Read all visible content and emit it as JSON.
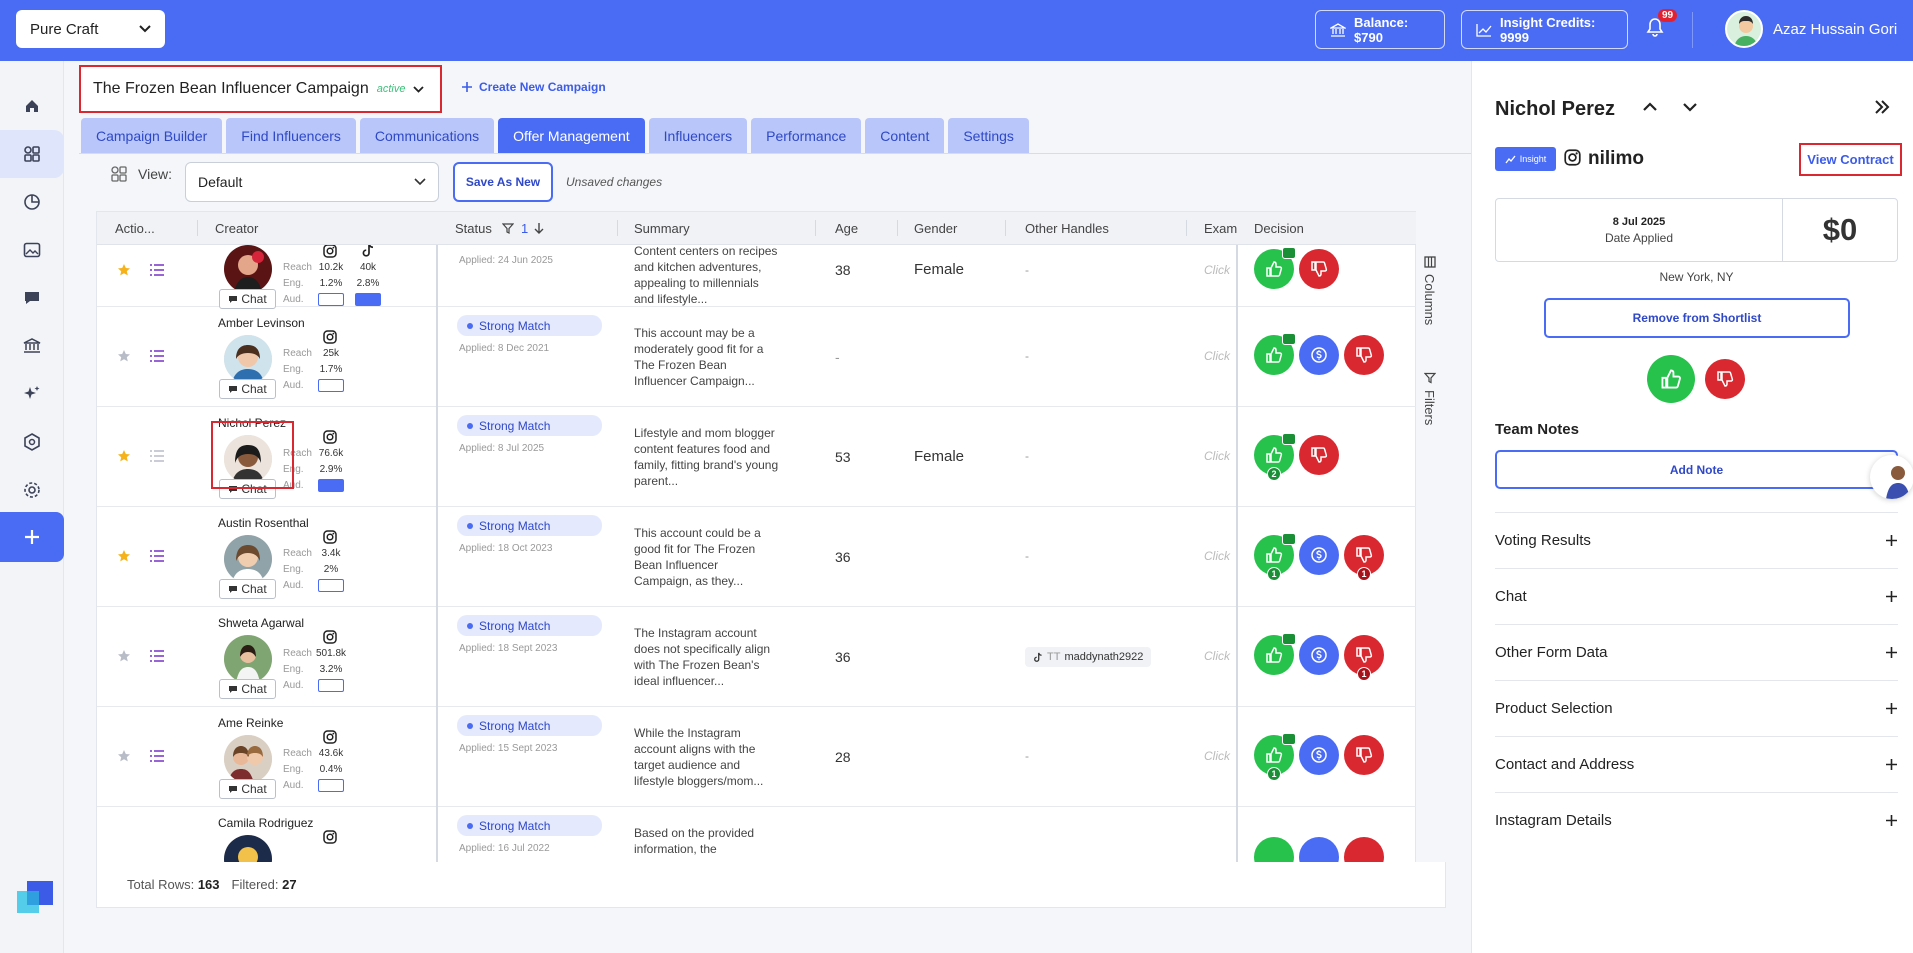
{
  "topbar": {
    "workspace": "Pure Craft",
    "balance": "Balance: $790",
    "credits": "Insight Credits: 9999",
    "notif_count": "99",
    "user_name": "Azaz Hussain Gori",
    "color": "#4a6cf4"
  },
  "campaign": {
    "title": "The Frozen Bean Influencer Campaign",
    "status": "active",
    "create_label": "Create New Campaign"
  },
  "tabs": [
    "Campaign Builder",
    "Find Influencers",
    "Communications",
    "Offer Management",
    "Influencers",
    "Performance",
    "Content",
    "Settings"
  ],
  "active_tab": "Offer Management",
  "view": {
    "label": "View:",
    "selected": "Default",
    "save_label": "Save As New",
    "unsaved": "Unsaved changes"
  },
  "table": {
    "headers": {
      "actions": "Actio...",
      "creator": "Creator",
      "status": "Status",
      "status_filter_count": "1",
      "summary": "Summary",
      "age": "Age",
      "gender": "Gender",
      "other_handles": "Other Handles",
      "exam": "Exam",
      "decision": "Decision"
    },
    "metric_labels": {
      "reach": "Reach",
      "eng": "Eng.",
      "aud": "Aud."
    },
    "chat_label": "Chat",
    "click_text": "Click",
    "rows": [
      {
        "name": "",
        "status": "",
        "applied": "Applied: 24 Jun 2025",
        "summary": "Content centers on recipes and kitchen adventures, appealing to millennials and lifestyle...",
        "age": "38",
        "gender": "Female",
        "handles": "-",
        "reach": "10.2k",
        "reach2": "40k",
        "eng": "1.2%",
        "eng2": "2.8%",
        "starred": true
      },
      {
        "name": "Amber Levinson",
        "status": "Strong Match",
        "applied": "Applied: 8 Dec 2021",
        "summary": "This account may be a moderately good fit for a The Frozen Bean Influencer Campaign...",
        "age": "-",
        "gender": "",
        "handles": "-",
        "reach": "25k",
        "eng": "1.7%",
        "starred": false
      },
      {
        "name": "Nichol Perez",
        "status": "Strong Match",
        "applied": "Applied: 8 Jul 2025",
        "summary": "Lifestyle and mom blogger content features food and family, fitting brand's young parent...",
        "age": "53",
        "gender": "Female",
        "handles": "-",
        "reach": "76.6k",
        "eng": "2.9%",
        "starred": true,
        "up_count": "2"
      },
      {
        "name": "Austin Rosenthal",
        "status": "Strong Match",
        "applied": "Applied: 18 Oct 2023",
        "summary": "This account could be a good fit for The Frozen Bean Influencer Campaign, as they...",
        "age": "36",
        "gender": "",
        "handles": "-",
        "reach": "3.4k",
        "eng": "2%",
        "starred": true,
        "up_count": "1",
        "down_count": "1"
      },
      {
        "name": "Shweta Agarwal",
        "status": "Strong Match",
        "applied": "Applied: 18 Sept 2023",
        "summary": "The Instagram account does not specifically align with The Frozen Bean's ideal influencer...",
        "age": "36",
        "gender": "",
        "handles": "maddynath2922",
        "handle_prefix": "TT",
        "reach": "501.8k",
        "eng": "3.2%",
        "starred": false,
        "down_count": "1"
      },
      {
        "name": "Ame Reinke",
        "status": "Strong Match",
        "applied": "Applied: 15 Sept 2023",
        "summary": "While the Instagram account aligns with the target audience and lifestyle bloggers/mom...",
        "age": "28",
        "gender": "",
        "handles": "-",
        "reach": "43.6k",
        "eng": "0.4%",
        "starred": false,
        "up_count": "1"
      },
      {
        "name": "Camila Rodriguez",
        "status": "Strong Match",
        "applied": "Applied: 16 Jul 2022",
        "summary": "Based on the provided information, the",
        "age": "",
        "gender": "",
        "handles": "",
        "starred": false
      }
    ],
    "side_tools": {
      "columns": "Columns",
      "filters": "Filters"
    },
    "footer": {
      "total_label": "Total Rows:",
      "total": "163",
      "filtered_label": "Filtered:",
      "filtered": "27"
    }
  },
  "panel": {
    "name": "Nichol Perez",
    "insight_badge": "Insight",
    "handle": "nilimo",
    "view_contract": "View Contract",
    "date": "8 Jul 2025",
    "date_label": "Date Applied",
    "amount": "$0",
    "location": "New York, NY",
    "remove_label": "Remove from Shortlist",
    "team_notes": "Team Notes",
    "add_note": "Add Note",
    "sections": [
      "Voting Results",
      "Chat",
      "Other Form Data",
      "Product Selection",
      "Contact and Address",
      "Instagram Details"
    ]
  }
}
